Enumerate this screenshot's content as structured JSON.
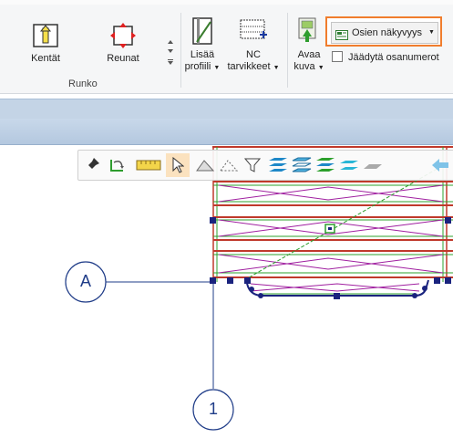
{
  "ribbon": {
    "group_label": "Runko",
    "buttons": {
      "kentat": "Kentät",
      "reunat": "Reunat",
      "lisaa_line1": "Lisää",
      "lisaa_line2": "profiili",
      "nc_line1": "NC",
      "nc_line2": "tarvikkeet",
      "avaa_line1": "Avaa",
      "avaa_line2": "kuva"
    },
    "dropdown_label": "Osien näkyvyys",
    "checkbox_label": "Jäädytä osanumerot",
    "colors": {
      "highlight_border": "#f07d2d",
      "ribbon_bg": "#f5f6f7"
    }
  },
  "drawing": {
    "grid_labels": {
      "row": "A",
      "column": "1"
    },
    "colors": {
      "grid_line": "#1f3c88",
      "frame_red": "#c0392b",
      "frame_green": "#2ca02c",
      "diagonal_magenta": "#a020a0",
      "handle": "#1a237e",
      "guide_green": "#2e9d2e"
    }
  },
  "toolbar": {
    "icons": [
      "pin-icon",
      "rotate-view-icon",
      "ruler-icon",
      "pointer-icon",
      "plane-icon",
      "dashed-plane-icon",
      "filter-icon",
      "layers-blue-icon",
      "layers-outline-icon",
      "layers-green-icon",
      "layers-cyan-icon",
      "flat-plane-icon",
      "back-arrow-icon"
    ]
  }
}
